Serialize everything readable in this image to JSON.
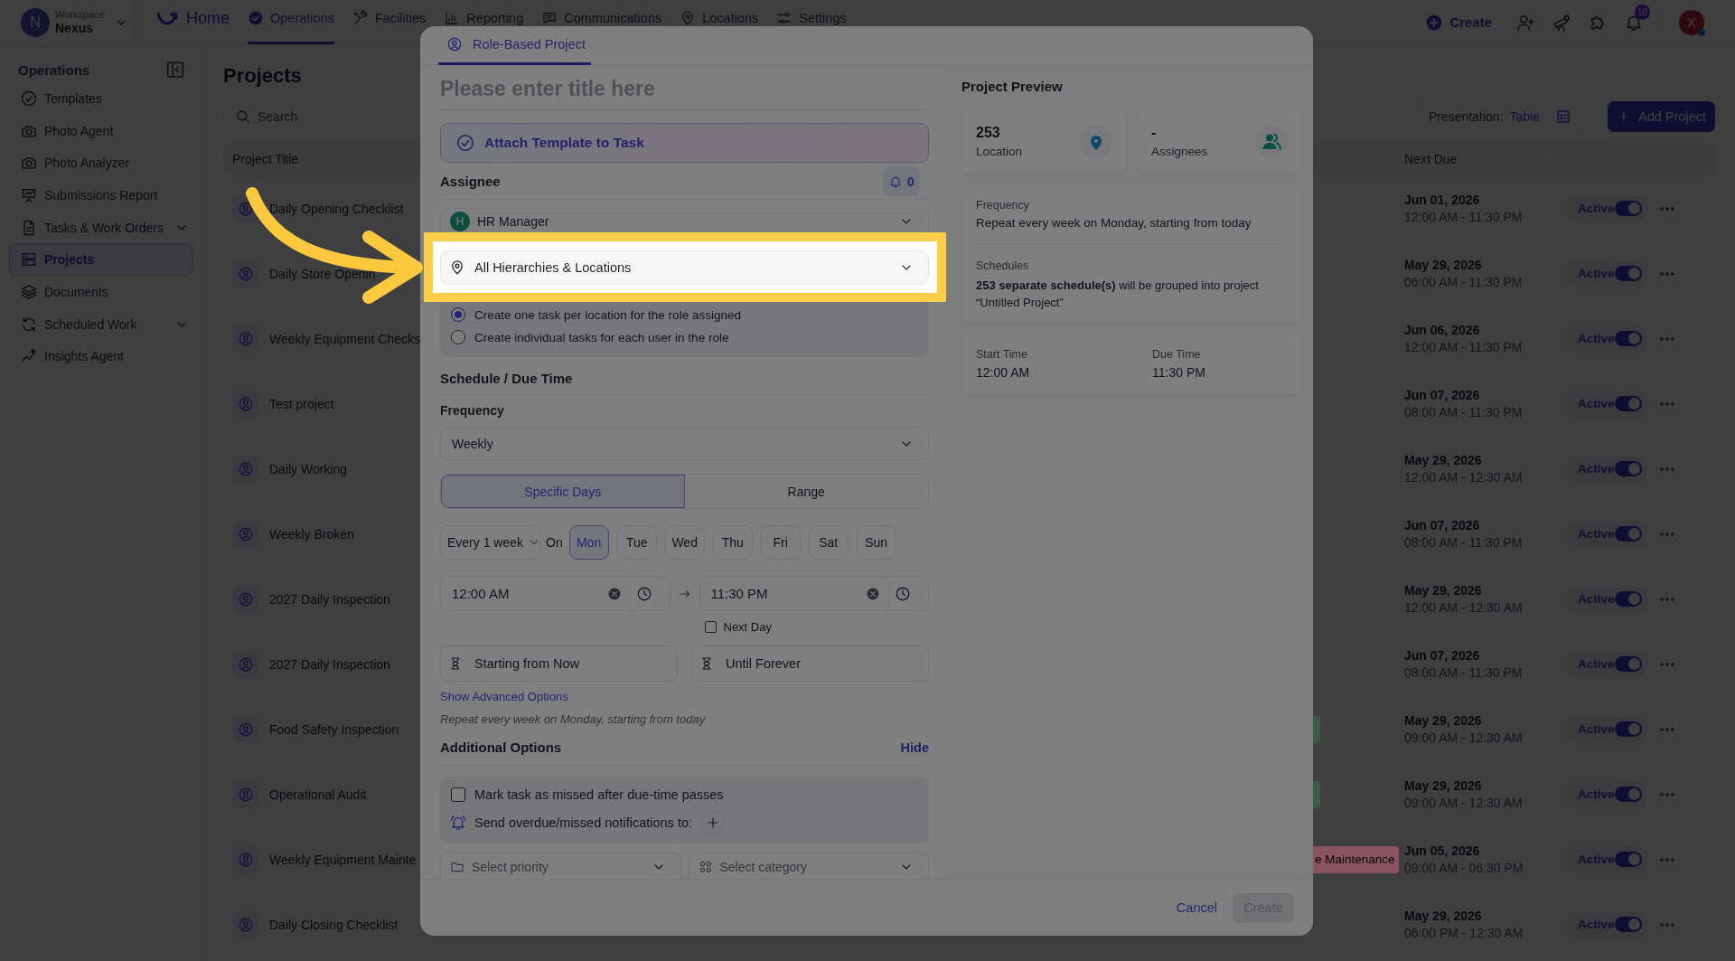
{
  "top_bar": {
    "workspace": {
      "avatar": "N",
      "label": "Workspace",
      "name": "Nexus"
    },
    "nav": [
      {
        "label": "Home",
        "kind": "home",
        "selected": false
      },
      {
        "label": "Operations",
        "kind": "link",
        "selected": true
      },
      {
        "label": "Facilities",
        "kind": "link",
        "selected": false
      },
      {
        "label": "Reporting",
        "kind": "link",
        "selected": false
      },
      {
        "label": "Communications",
        "kind": "link",
        "selected": false
      },
      {
        "label": "Locations",
        "kind": "link",
        "selected": false
      },
      {
        "label": "Settings",
        "kind": "link",
        "selected": false
      }
    ],
    "create": "Create",
    "notification_count": "10",
    "avatar": "X"
  },
  "sidebar": {
    "title": "Operations",
    "items": [
      {
        "label": "Templates",
        "selected": false,
        "has_submenu": false
      },
      {
        "label": "Photo Agent",
        "selected": false,
        "has_submenu": false
      },
      {
        "label": "Photo Analyzer",
        "selected": false,
        "has_submenu": false
      },
      {
        "label": "Submissions Report",
        "selected": false,
        "has_submenu": false
      },
      {
        "label": "Tasks & Work Orders",
        "selected": false,
        "has_submenu": true
      },
      {
        "label": "Projects",
        "selected": true,
        "has_submenu": false
      },
      {
        "label": "Documents",
        "selected": false,
        "has_submenu": false
      },
      {
        "label": "Scheduled Work",
        "selected": false,
        "has_submenu": true
      },
      {
        "label": "Insights Agent",
        "selected": false,
        "has_submenu": false
      }
    ]
  },
  "page": {
    "title": "Projects",
    "search": {
      "placeholder": "Search"
    },
    "presentation": {
      "label": "Presentation:",
      "value": "Table"
    },
    "add_button": "Add Project",
    "table": {
      "columns": [
        "Project Title",
        "Next Due"
      ],
      "rows": [
        {
          "title": "Daily Opening Checklist",
          "next_due_date": "Jun 01, 2026",
          "next_due_time": "12:00 AM - 11:30 PM",
          "status": "Active",
          "on": true
        },
        {
          "title": "Daily Store Openin",
          "next_due_date": "May 29, 2026",
          "next_due_time": "06:00 AM - 11:30 PM",
          "status": "Active",
          "on": true
        },
        {
          "title": "Weekly Equipment Checks",
          "next_due_date": "Jun 06, 2026",
          "next_due_time": "12:00 AM - 11:30 PM",
          "status": "Active",
          "on": true
        },
        {
          "title": "Test project",
          "next_due_date": "Jun 07, 2026",
          "next_due_time": "08:00 AM - 11:30 PM",
          "status": "Active",
          "on": true
        },
        {
          "title": "Daily Working",
          "next_due_date": "May 29, 2026",
          "next_due_time": "12:00 AM - 12:30 AM",
          "status": "Active",
          "on": true
        },
        {
          "title": "Weekly Broken",
          "next_due_date": "Jun 07, 2026",
          "next_due_time": "08:00 AM - 11:30 PM",
          "status": "Active",
          "on": true
        },
        {
          "title": "2027 Daily Inspection",
          "next_due_date": "May 29, 2026",
          "next_due_time": "12:00 AM - 12:30 AM",
          "status": "Active",
          "on": true
        },
        {
          "title": "2027 Daily Inspection",
          "next_due_date": "Jun 07, 2026",
          "next_due_time": "08:00 AM - 11:30 PM",
          "status": "Active",
          "on": true
        },
        {
          "title": "Food Safety Inspection",
          "tag": {
            "color": "#3e5a49"
          },
          "next_due_date": "May 29, 2026",
          "next_due_time": "09:00 AM - 12:30 AM",
          "status": "Active",
          "on": true
        },
        {
          "title": "Operational Audit",
          "tag": {
            "color": "#3e5a49"
          },
          "next_due_date": "May 29, 2026",
          "next_due_time": "09:00 AM - 12:30 AM",
          "status": "Active",
          "on": true
        },
        {
          "title": "Weekly Equipment Mainte",
          "tag": {
            "text": "e Maintenance",
            "color": "#8a5560"
          },
          "next_due_date": "Jun 05, 2026",
          "next_due_time": "09:00 AM - 06:30 PM",
          "status": "Active",
          "on": true
        },
        {
          "title": "Daily Closing Checklist",
          "next_due_date": "May 29, 2026",
          "next_due_time": "06:00 PM - 12:30 AM",
          "status": "Active",
          "on": true
        }
      ]
    }
  },
  "modal": {
    "tabs": [
      {
        "label": "Role-Based Project",
        "selected": true
      }
    ],
    "title_field": {
      "placeholder": "Please enter title here"
    },
    "attach_button": "Attach Template to Task",
    "assignee": {
      "label": "Assignee",
      "notify_count": "0",
      "role": {
        "initial": "H",
        "name": "HR Manager"
      }
    },
    "location_field": {
      "value": "All Hierarchies & Locations",
      "highlighted": true
    },
    "task_mode": [
      {
        "label": "Create one task per location for the role assigned",
        "selected": true
      },
      {
        "label": "Create individual tasks for each user in the role",
        "selected": false
      }
    ],
    "schedule": {
      "title": "Schedule / Due Time",
      "frequency_label": "Frequency",
      "frequency": "Weekly",
      "modes": [
        {
          "label": "Specific Days",
          "selected": true
        },
        {
          "label": "Range",
          "selected": false
        }
      ],
      "interval": "Every 1 week",
      "on_label": "On",
      "days": [
        {
          "label": "Mon",
          "selected": true
        },
        {
          "label": "Tue",
          "selected": false
        },
        {
          "label": "Wed",
          "selected": false
        },
        {
          "label": "Thu",
          "selected": false
        },
        {
          "label": "Fri",
          "selected": false
        },
        {
          "label": "Sat",
          "selected": false
        },
        {
          "label": "Sun",
          "selected": false
        }
      ],
      "start_time": "12:00 AM",
      "end_time": "11:30 PM",
      "next_day": {
        "label": "Next Day",
        "checked": false
      },
      "start": "Starting from Now",
      "until": "Until Forever",
      "advanced_link": "Show Advanced Options",
      "summary": "Repeat every week on Monday, starting from today"
    },
    "additional": {
      "title": "Additional Options",
      "toggle": "Hide",
      "missed": {
        "label": "Mark task as missed after due-time passes",
        "checked": false
      },
      "notify_label": "Send overdue/missed notifications to:",
      "priority": {
        "placeholder": "Select priority"
      },
      "category": {
        "placeholder": "Select category"
      }
    },
    "preview": {
      "title": "Project Preview",
      "stats": [
        {
          "value": "253",
          "label": "Location",
          "kind": "location"
        },
        {
          "value": "-",
          "label": "Assignees",
          "kind": "assignees"
        }
      ],
      "frequency_label": "Frequency",
      "frequency": "Repeat every week on Monday, starting from today",
      "schedules_label": "Schedules",
      "schedules": "**253 separate schedule(s)** will be grouped into project “Untitled Project”",
      "times": [
        {
          "label": "Start Time",
          "value": "12:00 AM"
        },
        {
          "label": "Due Time",
          "value": "11:30 PM"
        }
      ]
    },
    "footer": {
      "cancel": "Cancel",
      "create": {
        "label": "Create",
        "disabled": true
      }
    }
  }
}
